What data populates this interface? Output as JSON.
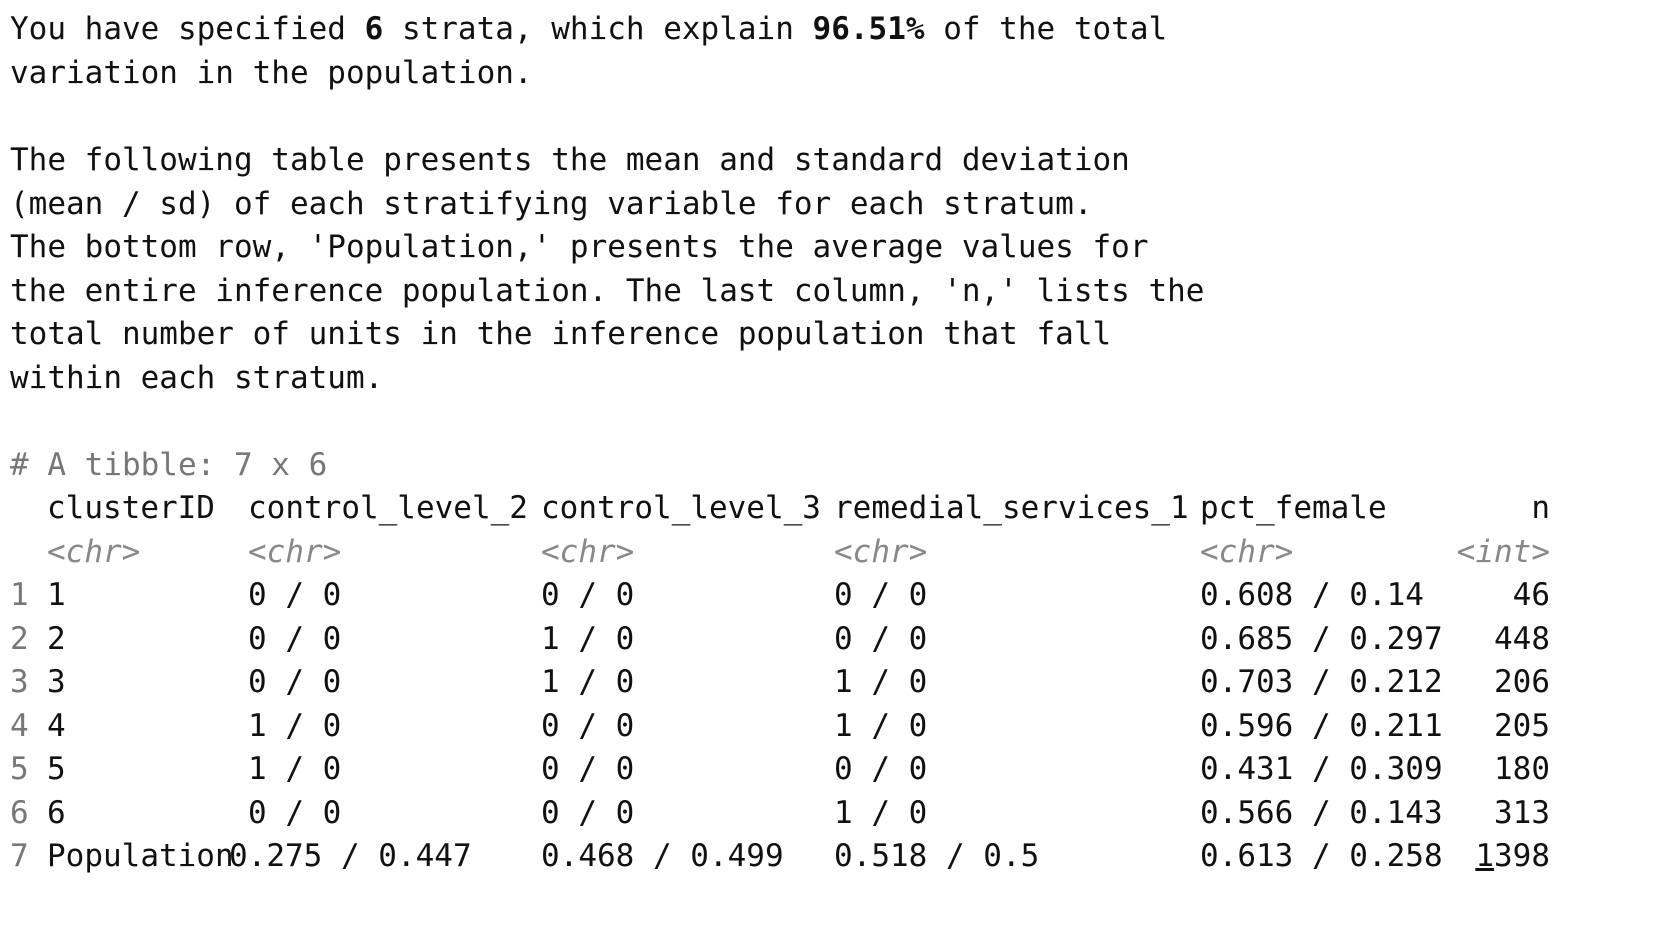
{
  "message": {
    "l1_a": "You have specified ",
    "l1_strata": "6",
    "l1_b": " strata, which explain ",
    "l1_pct": "96.51%",
    "l1_c": " of the total",
    "l2": "variation in the population.",
    "l3": "The following table presents the mean and standard deviation",
    "l4": "(mean / sd) of each stratifying variable for each stratum.",
    "l5": "The bottom row, 'Population,' presents the average values for",
    "l6": "the entire inference population. The last column, 'n,' lists the",
    "l7": "total number of units in the inference population that fall",
    "l8": "within each stratum."
  },
  "tibble": {
    "header_comment": "# A tibble: 7 x 6",
    "columns": [
      "clusterID",
      "control_level_2",
      "control_level_3",
      "remedial_services_1",
      "pct_female",
      "n"
    ],
    "types": [
      "<chr>",
      "<chr>",
      "<chr>",
      "<chr>",
      "<chr>",
      "<int>"
    ],
    "row_numbers": [
      "1",
      "2",
      "3",
      "4",
      "5",
      "6",
      "7"
    ],
    "rows": [
      [
        "1",
        "0 / 0",
        "0 / 0",
        "0 / 0",
        "0.608 / 0.14",
        "46"
      ],
      [
        "2",
        "0 / 0",
        "1 / 0",
        "0 / 0",
        "0.685 / 0.297",
        "448"
      ],
      [
        "3",
        "0 / 0",
        "1 / 0",
        "1 / 0",
        "0.703 / 0.212",
        "206"
      ],
      [
        "4",
        "1 / 0",
        "0 / 0",
        "1 / 0",
        "0.596 / 0.211",
        "205"
      ],
      [
        "5",
        "1 / 0",
        "0 / 0",
        "0 / 0",
        "0.431 / 0.309",
        "180"
      ],
      [
        "6",
        "0 / 0",
        "0 / 0",
        "1 / 0",
        "0.566 / 0.143",
        "313"
      ],
      [
        "Population",
        "0.275 / 0.447",
        "0.468 / 0.499",
        "0.518 / 0.5",
        "0.613 / 0.258",
        "1398"
      ]
    ],
    "n_thousands_digit": "1",
    "n_rest_digits": "398"
  }
}
